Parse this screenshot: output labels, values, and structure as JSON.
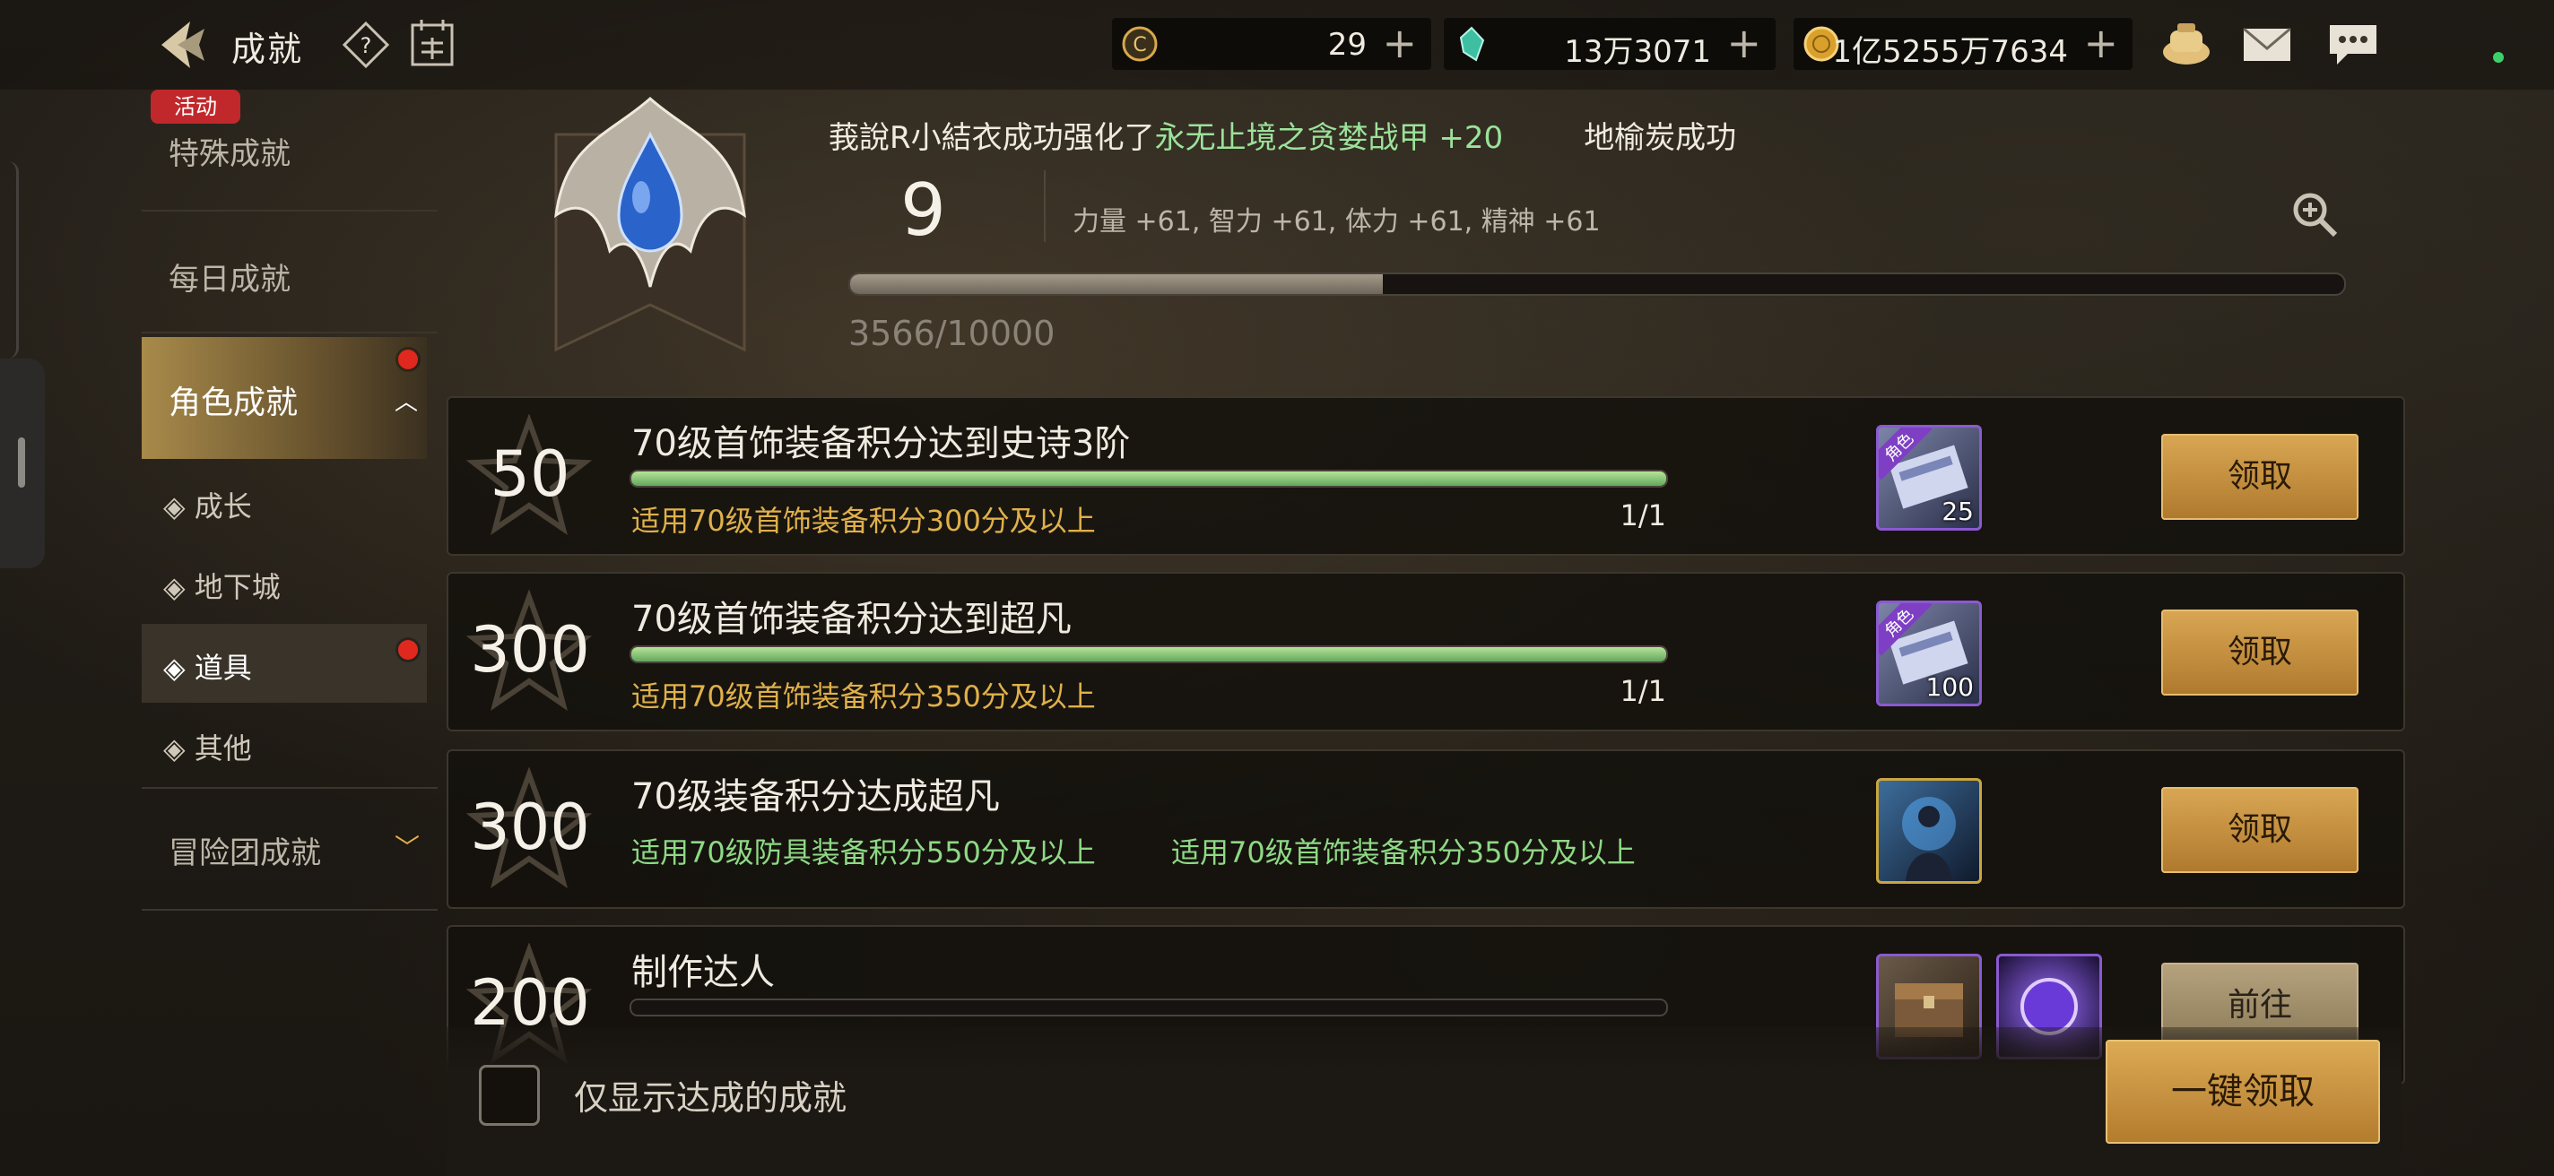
{
  "header": {
    "title": "成就",
    "currencies": [
      {
        "name": "c-coin",
        "value": "29"
      },
      {
        "name": "crystal",
        "value": "13万3071"
      },
      {
        "name": "gold",
        "value": "1亿5255万7634"
      }
    ]
  },
  "sidebar": {
    "event_badge": "活动",
    "special": "特殊成就",
    "daily": "每日成就",
    "character": "角色成就",
    "sub_items": [
      "◈ 成长",
      "◈ 地下城",
      "◈ 道具",
      "◈ 其他"
    ],
    "adventure": "冒险团成就"
  },
  "panel": {
    "ticker_prefix": "莪說R小結衣成功强化了",
    "ticker_item": "永无止境之贪婪战甲 +20",
    "ticker_suffix": "地榆炭成功",
    "level": "9",
    "stats": "力量 +61, 智力 +61, 体力 +61, 精神 +61",
    "exp_text": "3566/10000",
    "exp_fraction": 0.3566
  },
  "achievements": [
    {
      "points": "50",
      "title": "70级首饰装备积分达到史诗3阶",
      "condition": "适用70级首饰装备积分300分及以上",
      "progress": "1/1",
      "progress_fraction": 1.0,
      "reward_count": "25",
      "reward_tag": "角色",
      "button": "领取"
    },
    {
      "points": "300",
      "title": "70级首饰装备积分达到超凡",
      "condition": "适用70级首饰装备积分350分及以上",
      "progress": "1/1",
      "progress_fraction": 1.0,
      "reward_count": "100",
      "reward_tag": "角色",
      "button": "领取"
    },
    {
      "points": "300",
      "title": "70级装备积分达成超凡",
      "condition": "适用70级防具装备积分550分及以上",
      "condition2": "适用70级首饰装备积分350分及以上",
      "button": "领取"
    },
    {
      "points": "200",
      "title": "制作达人",
      "button": "前往",
      "progress_fraction": 0.0
    }
  ],
  "footer": {
    "checkbox_label": "仅显示达成的成就",
    "claim_all": "一键领取"
  }
}
